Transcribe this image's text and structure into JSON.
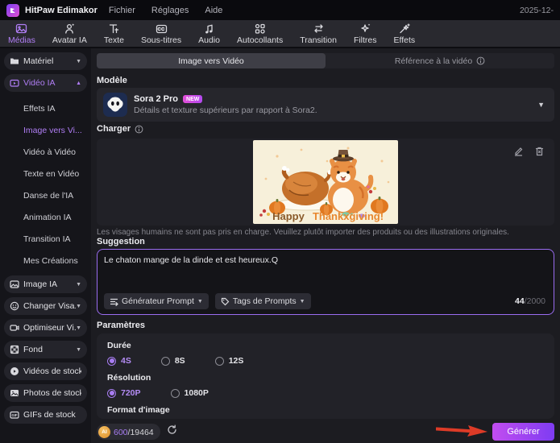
{
  "titlebar": {
    "app_name": "HitPaw Edimakor",
    "menus": [
      "Fichier",
      "Réglages",
      "Aide"
    ],
    "date": "2025-12-"
  },
  "toolbar": {
    "items": [
      {
        "label": "Médias",
        "icon": "media-icon",
        "active": true
      },
      {
        "label": "Avatar IA",
        "icon": "avatar-ai-icon",
        "active": false
      },
      {
        "label": "Texte",
        "icon": "text-icon",
        "active": false
      },
      {
        "label": "Sous-titres",
        "icon": "subtitles-icon",
        "active": false
      },
      {
        "label": "Audio",
        "icon": "audio-icon",
        "active": false
      },
      {
        "label": "Autocollants",
        "icon": "stickers-icon",
        "active": false
      },
      {
        "label": "Transition",
        "icon": "transition-icon",
        "active": false
      },
      {
        "label": "Filtres",
        "icon": "filters-icon",
        "active": false
      },
      {
        "label": "Effets",
        "icon": "effects-icon",
        "active": false
      }
    ]
  },
  "sidebar": {
    "materiel": {
      "label": "Matériel",
      "icon": "folder-icon"
    },
    "video_ai": {
      "label": "Vidéo IA",
      "icon": "video-ai-icon",
      "expanded": true
    },
    "video_ai_items": [
      {
        "label": "Effets IA",
        "active": false
      },
      {
        "label": "Image vers Vi...",
        "active": true
      },
      {
        "label": "Vidéo à Vidéo",
        "active": false
      },
      {
        "label": "Texte en Vidéo",
        "active": false
      },
      {
        "label": "Danse de l'IA",
        "active": false
      },
      {
        "label": "Animation IA",
        "active": false
      },
      {
        "label": "Transition IA",
        "active": false
      },
      {
        "label": "Mes Créations",
        "active": false
      }
    ],
    "groups": [
      {
        "label": "Image IA",
        "icon": "image-ai-icon",
        "collapsible": true
      },
      {
        "label": "Changer Visa...",
        "icon": "face-swap-icon",
        "collapsible": true
      },
      {
        "label": "Optimiseur Vi...",
        "icon": "video-enhance-icon",
        "collapsible": true
      },
      {
        "label": "Fond",
        "icon": "background-icon",
        "collapsible": true
      },
      {
        "label": "Vidéos de stock",
        "icon": "stock-video-icon",
        "collapsible": false
      },
      {
        "label": "Photos de stock",
        "icon": "stock-photo-icon",
        "collapsible": false
      },
      {
        "label": "GIFs de stock",
        "icon": "stock-gif-icon",
        "collapsible": false
      }
    ]
  },
  "main": {
    "tabs": [
      {
        "label": "Image vers Vidéo",
        "active": true
      },
      {
        "label": "Référence à la vidéo",
        "active": false,
        "info_icon": true
      }
    ],
    "model": {
      "section_label": "Modèle",
      "name": "Sora 2 Pro",
      "badge": "NEW",
      "description": "Détails et texture supérieurs par rapport à Sora2."
    },
    "upload": {
      "section_label": "Charger",
      "image_text_1": "Happy",
      "image_text_2": "Thankxgiving!",
      "warning": "Les visages humains ne sont pas pris en charge. Veuillez plutôt importer des produits ou des illustrations originales."
    },
    "prompt": {
      "section_label": "Suggestion",
      "value": "Le chaton mange de la dinde et est heureux.Q",
      "generator_button": "Générateur Prompt",
      "tags_button": "Tags de Prompts",
      "char_count": "44",
      "char_limit": "/2000"
    },
    "params": {
      "section_label": "Paramètres",
      "duration_label": "Durée",
      "duration_options": [
        {
          "label": "4S",
          "selected": true
        },
        {
          "label": "8S",
          "selected": false
        },
        {
          "label": "12S",
          "selected": false
        }
      ],
      "resolution_label": "Résolution",
      "resolution_options": [
        {
          "label": "720P",
          "selected": true
        },
        {
          "label": "1080P",
          "selected": false
        }
      ],
      "format_label": "Format d'image"
    },
    "footer": {
      "coin_text": "AI",
      "credits_used": "600",
      "credits_total": "/19464",
      "generate_label": "Générer"
    }
  },
  "colors": {
    "accent": "#a87df2",
    "new_badge": "#d84fd4",
    "generate_gradient_start": "#c24df0",
    "generate_gradient_end": "#7e3cf2",
    "annotation_arrow": "#dd3b27",
    "coin_gold": "#e8a33d"
  }
}
